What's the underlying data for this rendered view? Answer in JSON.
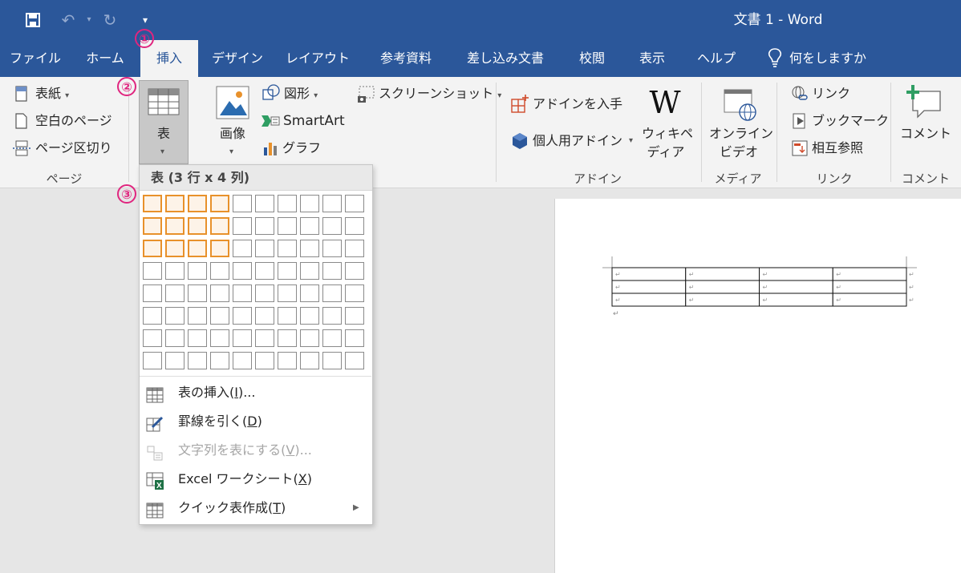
{
  "window": {
    "title": "文書 1  -  Word"
  },
  "qat": {
    "save_icon": "save-icon",
    "undo_icon": "undo-icon",
    "redo_icon": "redo-icon",
    "customize_icon": "customize-qat-icon"
  },
  "tabs": [
    {
      "label": "ファイル"
    },
    {
      "label": "ホーム"
    },
    {
      "label": "挿入"
    },
    {
      "label": "デザイン"
    },
    {
      "label": "レイアウト"
    },
    {
      "label": "参考資料"
    },
    {
      "label": "差し込み文書"
    },
    {
      "label": "校閲"
    },
    {
      "label": "表示"
    },
    {
      "label": "ヘルプ"
    }
  ],
  "tell_me": {
    "placeholder": "何をしますか"
  },
  "ribbon": {
    "pages": {
      "cover": "表紙",
      "blank": "空白のページ",
      "break": "ページ区切り",
      "group_label": "ページ"
    },
    "table": {
      "label": "表"
    },
    "illustrations": {
      "picture": "画像",
      "shapes": "図形",
      "smartart": "SmartArt",
      "chart": "グラフ",
      "screenshot": "スクリーンショット"
    },
    "addins": {
      "get": "アドインを入手",
      "my": "個人用アドイン",
      "wiki_line1": "ウィキペ",
      "wiki_line2": "ディア",
      "group_label": "アドイン"
    },
    "media": {
      "online_line1": "オンライン",
      "online_line2": "ビデオ",
      "group_label": "メディア"
    },
    "links": {
      "link": "リンク",
      "bookmark": "ブックマーク",
      "crossref": "相互参照",
      "group_label": "リンク"
    },
    "comments": {
      "comment": "コメント",
      "group_label": "コメント"
    }
  },
  "table_dropdown": {
    "header": "表 (3 行 x 4 列)",
    "grid": {
      "cols": 10,
      "rows": 8,
      "selected_rows": 3,
      "selected_cols": 4
    },
    "menu": [
      {
        "pre": "表の挿入(",
        "key": "I",
        "post": ")...",
        "enabled": true,
        "icon": "insert-table-icon"
      },
      {
        "pre": "罫線を引く(",
        "key": "D",
        "post": ")",
        "enabled": true,
        "icon": "draw-table-icon"
      },
      {
        "pre": "文字列を表にする(",
        "key": "V",
        "post": ")...",
        "enabled": false,
        "icon": "text-to-table-icon"
      },
      {
        "pre": "Excel ワークシート(",
        "key": "X",
        "post": ")",
        "enabled": true,
        "icon": "excel-sheet-icon"
      },
      {
        "pre": "クイック表作成(",
        "key": "T",
        "post": ")",
        "enabled": true,
        "icon": "quick-tables-icon"
      }
    ]
  },
  "annotations": [
    "①",
    "②",
    "③"
  ],
  "document": {
    "table": {
      "rows": 3,
      "cols": 4,
      "mark": "↵"
    },
    "after_mark": "↵"
  },
  "colors": {
    "brand": "#2b579a",
    "selection": "#e8912b",
    "badge": "#e0257f"
  }
}
